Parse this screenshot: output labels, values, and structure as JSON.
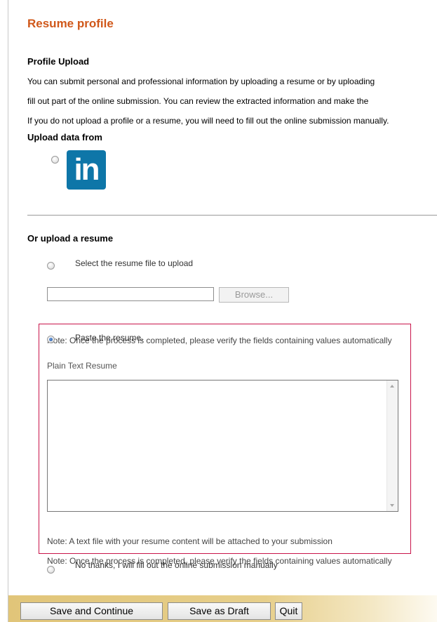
{
  "page": {
    "title": "Resume profile"
  },
  "profile_upload": {
    "heading": "Profile Upload",
    "lines": [
      "You can submit personal and professional information by uploading a resume or by uploading",
      "fill out part of the online submission. You can review the extracted information and make the",
      "If you do not upload a profile or a resume, you will need to fill out the online submission manually."
    ]
  },
  "upload_data_from": {
    "heading": "Upload data from",
    "linkedin_logo_text": "in"
  },
  "resume_upload": {
    "heading": "Or upload a resume",
    "option_file_label": "Select the resume file to upload",
    "file_input_value": "",
    "browse_label": "Browse...",
    "note_file": "Note: Once the process is completed, please verify the fields containing values automatically",
    "option_paste_label": "Paste the resume.",
    "plain_text_label": "Plain Text Resume",
    "textarea_value": "",
    "note_paste": "Note: Once the process is completed, please verify the fields containing values automatically",
    "note_attach": "Note: A text file with your resume content will be attached to your submission",
    "option_manual_label": "No thanks, I will fill out the online submission manually"
  },
  "footer": {
    "save_continue": "Save and Continue",
    "save_draft": "Save as Draft",
    "quit": "Quit"
  },
  "colors": {
    "title": "#d0581a",
    "linkedin": "#0e76a8",
    "highlight_border": "#c8144a"
  }
}
